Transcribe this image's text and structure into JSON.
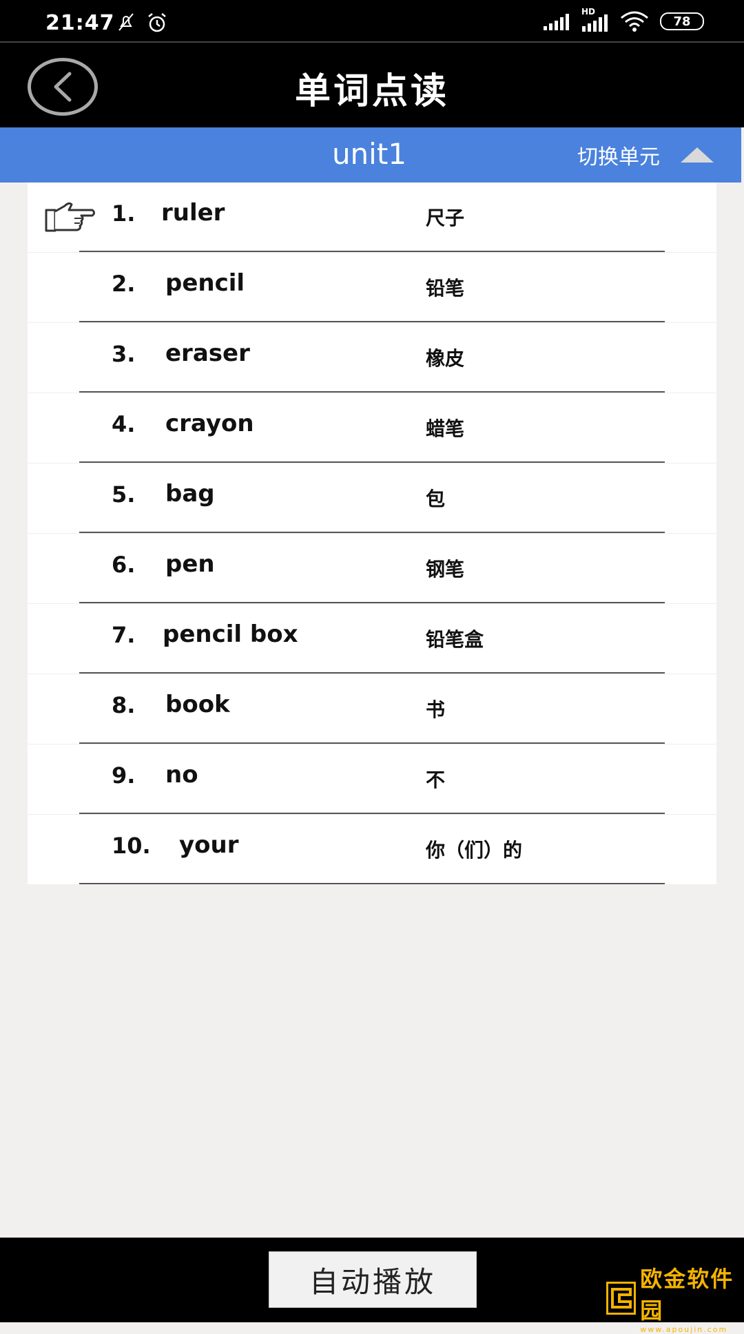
{
  "status_bar": {
    "time": "21:47",
    "battery": "78",
    "network_label": "HD"
  },
  "header": {
    "title": "单词点读"
  },
  "unit_bar": {
    "unit_name": "unit1",
    "switch_label": "切换单元"
  },
  "words": [
    {
      "num": "1.",
      "en": "ruler",
      "cn": "尺子"
    },
    {
      "num": "2.",
      "en": "pencil",
      "cn": "铅笔"
    },
    {
      "num": "3.",
      "en": "eraser",
      "cn": "橡皮"
    },
    {
      "num": "4.",
      "en": "crayon",
      "cn": "蜡笔"
    },
    {
      "num": "5.",
      "en": "bag",
      "cn": "包"
    },
    {
      "num": "6.",
      "en": "pen",
      "cn": "钢笔"
    },
    {
      "num": "7.",
      "en": "pencil box",
      "cn": "铅笔盒"
    },
    {
      "num": "8.",
      "en": "book",
      "cn": "书"
    },
    {
      "num": "9.",
      "en": "no",
      "cn": "不"
    },
    {
      "num": "10.",
      "en": "your",
      "cn": "你（们）的"
    }
  ],
  "footer": {
    "autoplay_label": "自动播放",
    "watermark_text": "欧金软件园",
    "watermark_url": "www.apoujin.com"
  },
  "colors": {
    "unit_bar": "#4a82dd",
    "watermark": "#f2b200"
  },
  "icons": {
    "pointer": "pointing-hand-icon",
    "back": "back-arrow-icon",
    "collapse": "triangle-up-icon"
  }
}
